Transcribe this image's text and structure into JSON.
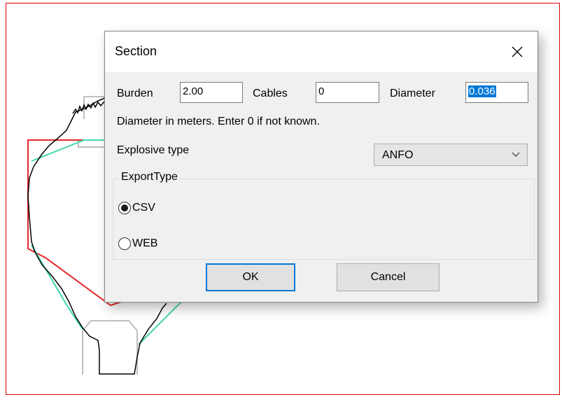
{
  "dialog": {
    "title": "Section",
    "burden_label": "Burden",
    "burden_value": "2.00",
    "cables_label": "Cables",
    "cables_value": "0",
    "diameter_label": "Diameter",
    "diameter_value": "0.036",
    "diameter_hint": "Diameter in meters. Enter 0 if not known.",
    "explosive_label": "Explosive type",
    "explosive_selected": "ANFO",
    "export_group_label": "ExportType",
    "export_options": [
      {
        "label": "CSV",
        "checked": true
      },
      {
        "label": "WEB",
        "checked": false
      }
    ],
    "ok_label": "OK",
    "cancel_label": "Cancel"
  },
  "colors": {
    "canvas_border": "#d60000",
    "selection": "#0078d7",
    "design_outline": "#e0282a",
    "offset_outline": "#40d8b0",
    "reference_outline": "#bfbfbf",
    "scan_profile": "#000000"
  },
  "icons": {
    "close": "close-icon",
    "dropdown": "chevron-down-icon"
  }
}
